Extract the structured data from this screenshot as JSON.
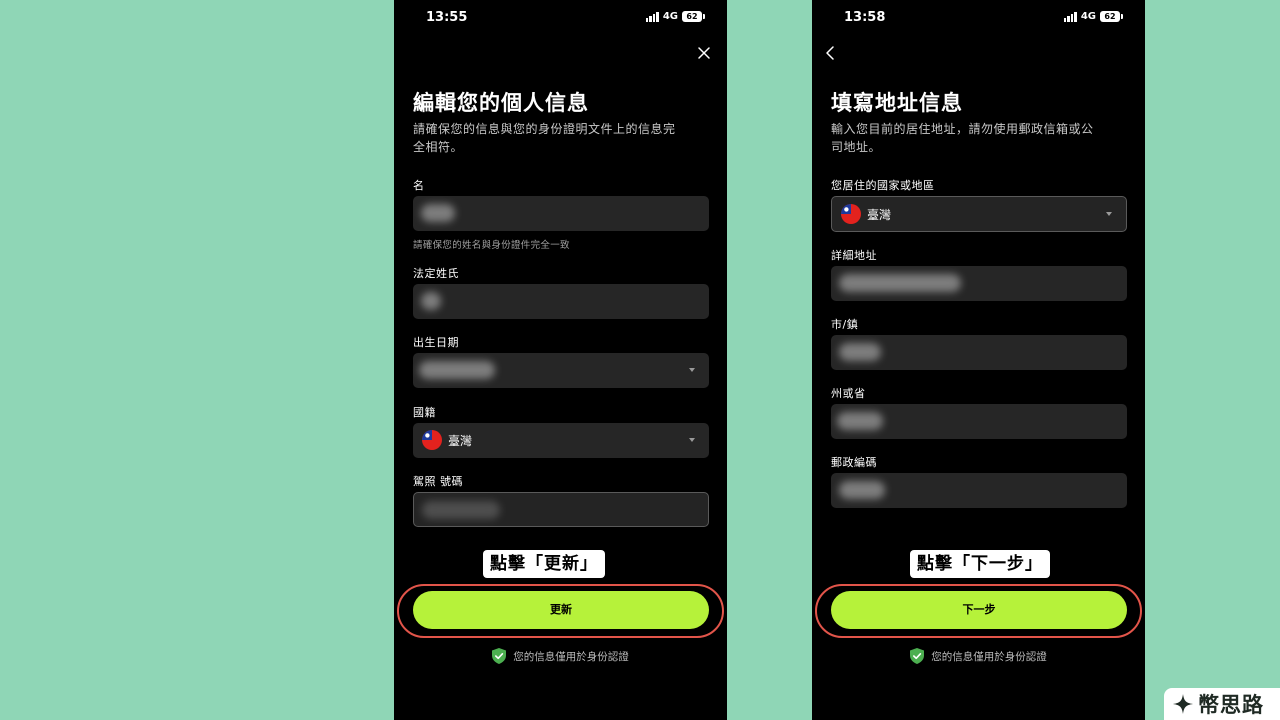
{
  "left": {
    "status": {
      "time": "13:55",
      "network": "4G",
      "battery": "62"
    },
    "title": "編輯您的個人信息",
    "subtitle": "請確保您的信息與您的身份證明文件上的信息完全相符。",
    "fields": {
      "first_name_label": "名",
      "first_name_hint": "請確保您的姓名與身份證件完全一致",
      "last_name_label": "法定姓氏",
      "dob_label": "出生日期",
      "nationality_label": "國籍",
      "nationality_value": "臺灣",
      "license_label": "駕照 號碼"
    },
    "callout": "點擊「更新」",
    "cta": "更新",
    "secure_note": "您的信息僅用於身份認證"
  },
  "right": {
    "status": {
      "time": "13:58",
      "network": "4G",
      "battery": "62"
    },
    "title": "填寫地址信息",
    "subtitle": "輸入您目前的居住地址，請勿使用郵政信箱或公司地址。",
    "fields": {
      "country_label": "您居住的國家或地區",
      "country_value": "臺灣",
      "address_label": "詳細地址",
      "city_label": "市/鎮",
      "state_label": "州或省",
      "postal_label": "郵政編碼"
    },
    "callout": "點擊「下一步」",
    "cta": "下一步",
    "secure_note": "您的信息僅用於身份認證"
  },
  "brand": {
    "name": "幣思路"
  },
  "colors": {
    "background": "#8fd6b6",
    "accent": "#b6f23a",
    "highlight": "#e2554a",
    "shield": "#4caf50"
  }
}
